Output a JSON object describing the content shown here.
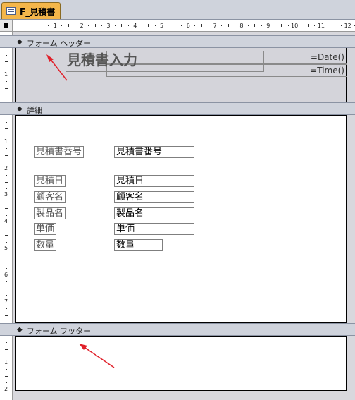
{
  "tab": {
    "label": "F_見積書",
    "icon": "form-icon"
  },
  "ruler": {
    "h_numbers": [
      "1",
      "2",
      "3",
      "4",
      "5",
      "6",
      "7",
      "8",
      "9",
      "10",
      "11",
      "12"
    ],
    "v_header": [
      "1"
    ],
    "v_detail": [
      "1",
      "2",
      "3",
      "4",
      "5",
      "6",
      "7"
    ],
    "v_footer": [
      "1",
      "2"
    ]
  },
  "sections": {
    "header": {
      "label": "フォーム ヘッダー"
    },
    "detail": {
      "label": "詳細"
    },
    "footer": {
      "label": "フォーム フッター"
    }
  },
  "header_controls": {
    "title": "見積書入力",
    "date_expr": "=Date()",
    "time_expr": "=Time()"
  },
  "fields": [
    {
      "label": "見積書番号",
      "value": "見積書番号"
    },
    {
      "label": "見積日",
      "value": "見積日"
    },
    {
      "label": "顧客名",
      "value": "顧客名"
    },
    {
      "label": "製品名",
      "value": "製品名"
    },
    {
      "label": "単価",
      "value": "単価"
    },
    {
      "label": "数量",
      "value": "数量"
    }
  ],
  "colors": {
    "tab": "#f4b64a",
    "arrow": "#e0202a",
    "section_bar": "#cfd3dc"
  }
}
